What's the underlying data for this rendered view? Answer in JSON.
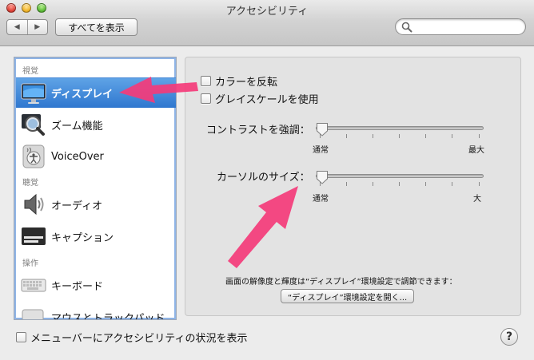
{
  "window": {
    "title": "アクセシビリティ"
  },
  "toolbar": {
    "back_glyph": "◀",
    "forward_glyph": "▶",
    "show_all_label": "すべてを表示",
    "search": {
      "value": "",
      "placeholder": ""
    }
  },
  "sidebar": {
    "sections": [
      {
        "label": "視覚"
      },
      {
        "label": "聴覚"
      },
      {
        "label": "操作"
      }
    ],
    "items": [
      {
        "label": "ディスプレイ",
        "icon": "display-icon",
        "selected": true
      },
      {
        "label": "ズーム機能",
        "icon": "zoom-icon",
        "selected": false
      },
      {
        "label": "VoiceOver",
        "icon": "voiceover-icon",
        "selected": false
      },
      {
        "label": "オーディオ",
        "icon": "speaker-icon",
        "selected": false
      },
      {
        "label": "キャプション",
        "icon": "caption-icon",
        "selected": false
      },
      {
        "label": "キーボード",
        "icon": "keyboard-icon",
        "selected": false
      },
      {
        "label": "マウスとトラックパッド",
        "icon": "mouse-icon",
        "selected": false
      }
    ]
  },
  "main": {
    "invert_colors": {
      "label": "カラーを反転",
      "checked": false
    },
    "grayscale": {
      "label": "グレイスケールを使用",
      "checked": false
    },
    "contrast": {
      "label": "コントラストを強調：",
      "min_label": "通常",
      "max_label": "最大",
      "value": 0
    },
    "cursor_size": {
      "label": "カーソルのサイズ：",
      "min_label": "通常",
      "max_label": "大",
      "value": 0
    },
    "info_text": "画面の解像度と輝度は“ディスプレイ”環境設定で調節できます：",
    "open_display_button": "“ディスプレイ”環境設定を開く..."
  },
  "footer": {
    "menubar_status": {
      "label": "メニューバーにアクセシビリティの状況を表示",
      "checked": false
    },
    "help_label": "?"
  },
  "colors": {
    "selection": "#3a82d6",
    "annotation_arrow": "#f43b7a"
  }
}
